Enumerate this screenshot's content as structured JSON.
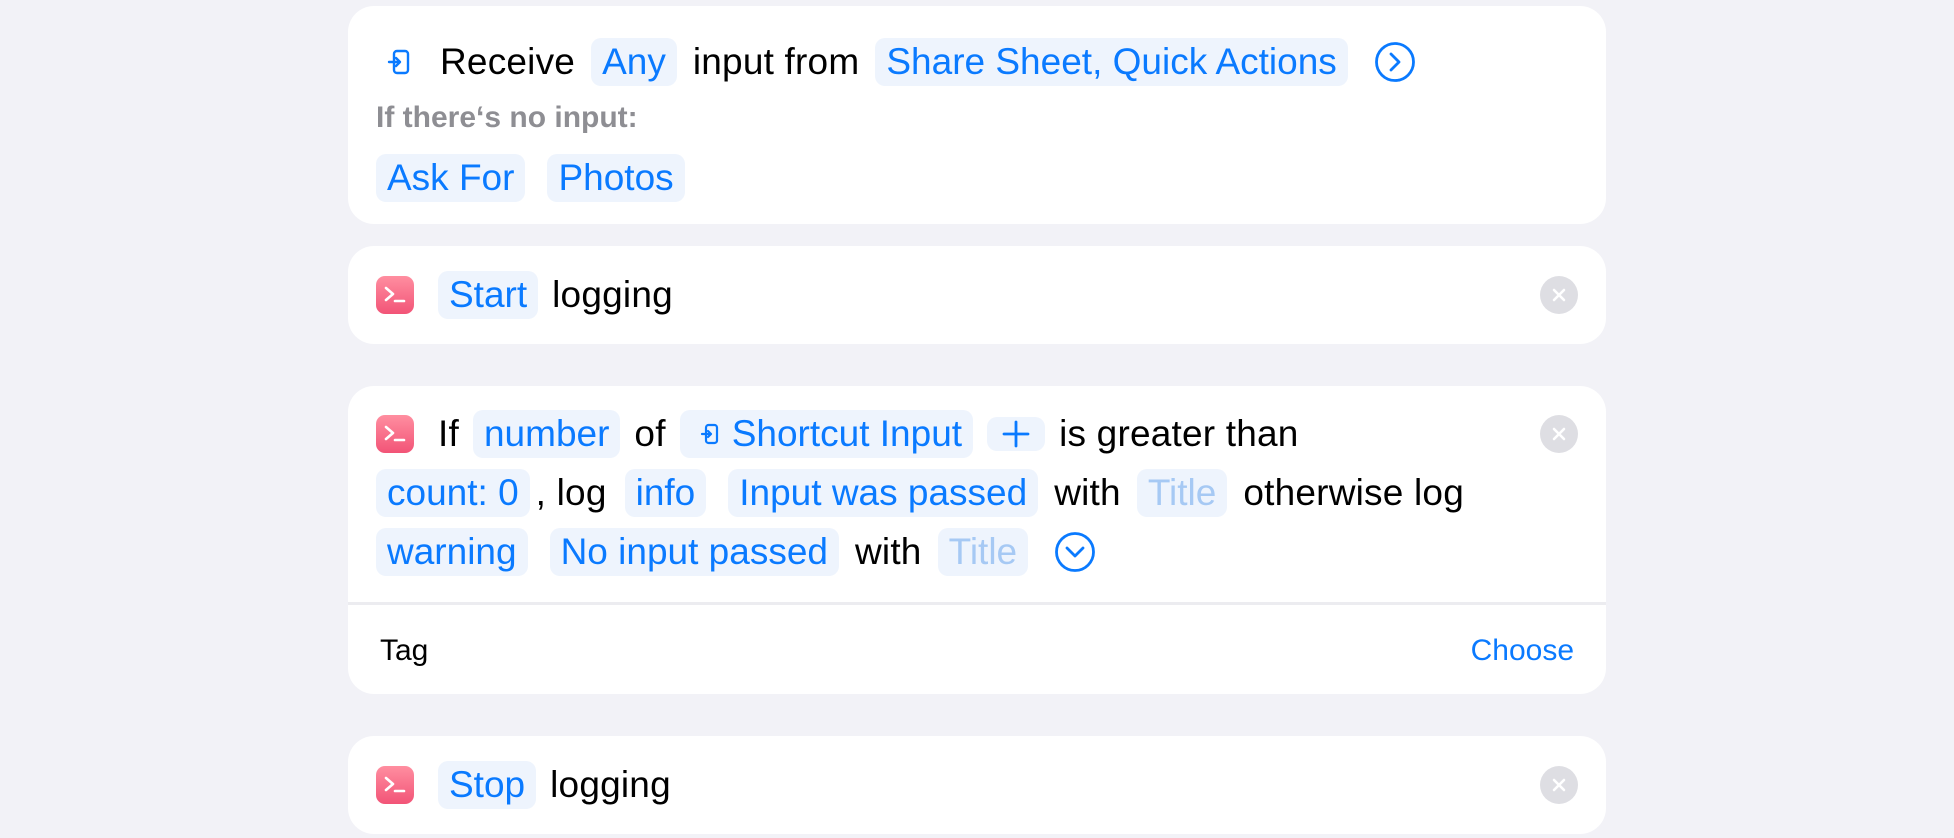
{
  "receive_action": {
    "receive_word": "Receive",
    "type_token": "Any",
    "input_from_word": "input from",
    "source_token": "Share Sheet, Quick Actions",
    "no_input_label": "If there‘s no input:",
    "fallback_token": "Ask For",
    "fallback_value_token": "Photos"
  },
  "start_action": {
    "verb_token": "Start",
    "object_word": "logging"
  },
  "if_action": {
    "if_word": "If",
    "property_token": "number",
    "of_word": "of",
    "variable_token": "Shortcut Input",
    "add_symbol": "+",
    "comparison_word": "is greater than",
    "value_token": "count: 0",
    "log_word": ", log",
    "level_token": "info",
    "message_token": "Input was passed",
    "with_word": "with",
    "title_placeholder": "Title",
    "otherwise_word": "otherwise log",
    "else_level_token": "warning",
    "else_message_token": "No input passed",
    "else_with_word": "with",
    "else_title_placeholder": "Title",
    "tag_label": "Tag",
    "tag_choose": "Choose"
  },
  "stop_action": {
    "verb_token": "Stop",
    "object_word": "logging"
  },
  "colors": {
    "accent": "#0a7aff",
    "token_bg": "#eef4fd",
    "background": "#f2f2f7",
    "icon_gradient_top": "#ff8ea0",
    "icon_gradient_bottom": "#f25477"
  }
}
